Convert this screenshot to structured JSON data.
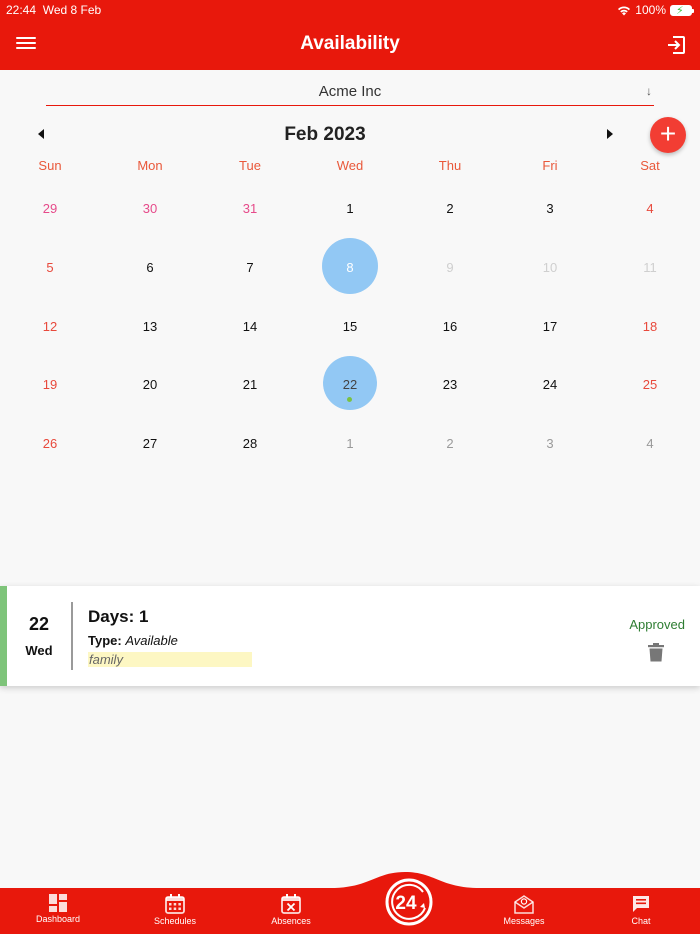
{
  "status_bar": {
    "time": "22:44",
    "date": "Wed 8 Feb",
    "battery": "100%"
  },
  "app_bar": {
    "title": "Availability",
    "menu_icon": "hamburger-menu-icon",
    "logout_icon": "logout-icon"
  },
  "company_select": {
    "value": "Acme Inc",
    "arrow": "↓"
  },
  "calendar": {
    "month_title": "Feb 2023",
    "weekdays": [
      "Sun",
      "Mon",
      "Tue",
      "Wed",
      "Thu",
      "Fri",
      "Sat"
    ],
    "weeks": [
      [
        {
          "d": "29",
          "c": "pink"
        },
        {
          "d": "30",
          "c": "pink"
        },
        {
          "d": "31",
          "c": "pink"
        },
        {
          "d": "1",
          "c": "black"
        },
        {
          "d": "2",
          "c": "black"
        },
        {
          "d": "3",
          "c": "black"
        },
        {
          "d": "4",
          "c": "red"
        }
      ],
      [
        {
          "d": "5",
          "c": "red"
        },
        {
          "d": "6",
          "c": "black"
        },
        {
          "d": "7",
          "c": "black"
        },
        {
          "d": "8",
          "c": "sel",
          "today": true
        },
        {
          "d": "9",
          "c": "light"
        },
        {
          "d": "10",
          "c": "light"
        },
        {
          "d": "11",
          "c": "light"
        }
      ],
      [
        {
          "d": "12",
          "c": "red"
        },
        {
          "d": "13",
          "c": "black"
        },
        {
          "d": "14",
          "c": "black"
        },
        {
          "d": "15",
          "c": "black"
        },
        {
          "d": "16",
          "c": "black"
        },
        {
          "d": "17",
          "c": "black"
        },
        {
          "d": "18",
          "c": "red"
        }
      ],
      [
        {
          "d": "19",
          "c": "red"
        },
        {
          "d": "20",
          "c": "black"
        },
        {
          "d": "21",
          "c": "black"
        },
        {
          "d": "22",
          "c": "blue",
          "selected": true,
          "event": true
        },
        {
          "d": "23",
          "c": "black"
        },
        {
          "d": "24",
          "c": "black"
        },
        {
          "d": "25",
          "c": "red"
        }
      ],
      [
        {
          "d": "26",
          "c": "red"
        },
        {
          "d": "27",
          "c": "black"
        },
        {
          "d": "28",
          "c": "black"
        },
        {
          "d": "1",
          "c": "grey"
        },
        {
          "d": "2",
          "c": "grey"
        },
        {
          "d": "3",
          "c": "grey"
        },
        {
          "d": "4",
          "c": "grey"
        }
      ]
    ]
  },
  "add_button": {
    "label": "+"
  },
  "entry": {
    "day_number": "22",
    "day_name": "Wed",
    "days_label": "Days: 1",
    "type_label": "Type:",
    "type_value": "Available",
    "note": "family",
    "status": "Approved",
    "stripe_color": "#7ec47a"
  },
  "bottom_nav": {
    "tabs": [
      {
        "label": "Dashboard",
        "icon": "dashboard-icon"
      },
      {
        "label": "Schedules",
        "icon": "calendar-icon"
      },
      {
        "label": "Absences",
        "icon": "calendar-x-icon"
      },
      {
        "label": "Messages",
        "icon": "envelope-icon"
      },
      {
        "label": "Chat",
        "icon": "chat-icon"
      }
    ],
    "center_logo": "24"
  },
  "colors": {
    "brand_red": "#e8180c",
    "selected_blue": "#92c8f4",
    "approved_green": "#2e7d32"
  }
}
